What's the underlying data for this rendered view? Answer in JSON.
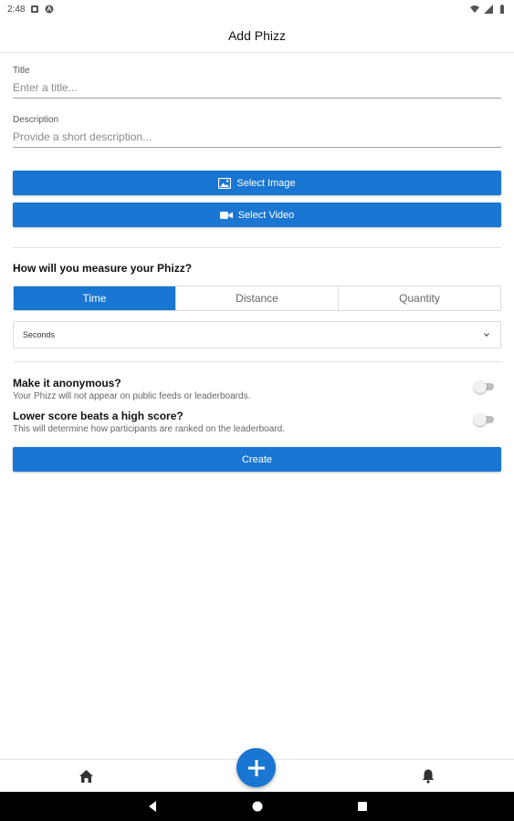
{
  "status_bar": {
    "time": "2:48",
    "icons": [
      "sim-icon",
      "app-notification-icon",
      "wifi-icon",
      "signal-icon",
      "battery-icon"
    ]
  },
  "header": {
    "title": "Add Phizz"
  },
  "form": {
    "title": {
      "label": "Title",
      "placeholder": "Enter a title...",
      "value": ""
    },
    "description": {
      "label": "Description",
      "placeholder": "Provide a short description...",
      "value": ""
    },
    "select_image_label": "Select Image",
    "select_image_icon": "image-icon",
    "select_video_label": "Select Video",
    "select_video_icon": "video-camera-icon",
    "measure": {
      "question": "How will you measure your Phizz?",
      "options": [
        "Time",
        "Distance",
        "Quantity"
      ],
      "selected": "Time",
      "unit_selected": "Seconds"
    },
    "anonymous": {
      "title": "Make it anonymous?",
      "description": "Your Phizz will not appear on public feeds or leaderboards.",
      "enabled": false
    },
    "lower_score": {
      "title": "Lower score beats a high score?",
      "description": "This will determine how participants are ranked on the leaderboard.",
      "enabled": false
    },
    "create_label": "Create"
  },
  "bottom_nav": {
    "left_icon": "home-icon",
    "center_icon": "plus-icon",
    "right_icon": "bell-icon"
  },
  "system_nav": [
    "back-icon",
    "home-circle-icon",
    "recents-icon"
  ],
  "colors": {
    "primary": "#1976d2",
    "divider": "#e0e0e0",
    "text": "#212121"
  }
}
